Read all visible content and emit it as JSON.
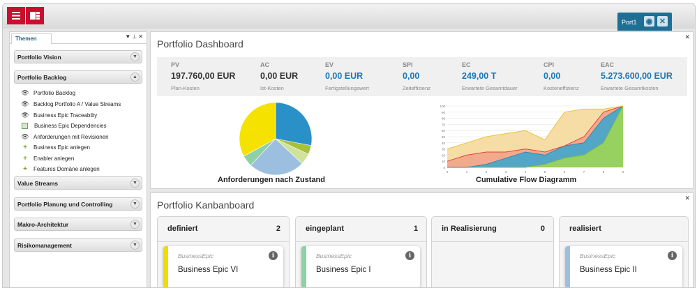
{
  "toolbar": {
    "menu_icon": "menu-icon",
    "layout_icon": "layout-icon"
  },
  "top_tab": {
    "label": "Port1"
  },
  "sidebar": {
    "tab_label": "Themen",
    "groups": [
      {
        "label": "Portfolio Vision",
        "expanded": false
      },
      {
        "label": "Portfolio Backlog",
        "expanded": true
      },
      {
        "label": "Value Streams",
        "expanded": false
      },
      {
        "label": "Portfolio Planung und Controlling",
        "expanded": false
      },
      {
        "label": "Makro-Architektur",
        "expanded": false
      },
      {
        "label": "Risikomanagement",
        "expanded": false
      }
    ],
    "items": [
      {
        "label": "Portfolio Backlog",
        "icon": "eye-icon"
      },
      {
        "label": "Backlog Portfolio A / Value Streams",
        "icon": "eye-icon"
      },
      {
        "label": "Business Epic Traceabilty",
        "icon": "eye-icon"
      },
      {
        "label": "Business Epic Dependencies",
        "icon": "diagram-icon"
      },
      {
        "label": "Anforderungen mit Revisionen",
        "icon": "eye-icon"
      },
      {
        "label": "Business Epic anlegen",
        "icon": "plus-icon"
      },
      {
        "label": "Enabler anlegen",
        "icon": "plus-icon"
      },
      {
        "label": "Features Domäne anlegen",
        "icon": "plus-icon"
      }
    ]
  },
  "dashboard": {
    "title": "Portfolio Dashboard",
    "kpis": [
      {
        "key": "PV",
        "value": "197.760,00 EUR",
        "sub": "Plan-Kosten",
        "color": "#333333"
      },
      {
        "key": "AC",
        "value": "0,00 EUR",
        "sub": "Ist-Kosten",
        "color": "#333333"
      },
      {
        "key": "EV",
        "value": "0,00 EUR",
        "sub": "Fertigstellungswert",
        "color": "#1a78b5"
      },
      {
        "key": "SPI",
        "value": "0,00",
        "sub": "Zeiteffizienz",
        "color": "#1a78b5"
      },
      {
        "key": "EC",
        "value": "249,00 T",
        "sub": "Erwartete Gesamtdauer",
        "color": "#1a78b5"
      },
      {
        "key": "CPI",
        "value": "0,00",
        "sub": "Kosteneffizienz",
        "color": "#1a78b5"
      },
      {
        "key": "EAC",
        "value": "5.273.600,00 EUR",
        "sub": "Erwartete Gesamtkosten",
        "color": "#1a78b5"
      }
    ],
    "pie_label": "Anforderungen nach Zustand",
    "cfd_label": "Cumulative Flow Diagramm"
  },
  "chart_data": [
    {
      "type": "pie",
      "title": "Anforderungen nach Zustand",
      "values": [
        28,
        4,
        5,
        25,
        5,
        33
      ],
      "colors": [
        "#2a90c8",
        "#a6c13a",
        "#cfe39a",
        "#9dbfdf",
        "#8fd0a6",
        "#f5e200"
      ]
    },
    {
      "type": "area",
      "title": "Cumulative Flow Diagramm",
      "x": [
        "0",
        "1",
        "2",
        "3",
        "4",
        "5",
        "6",
        "7",
        "8",
        "9"
      ],
      "ylim": [
        0,
        100
      ],
      "yticks": [
        "0",
        "10",
        "20",
        "30",
        "40",
        "50",
        "60",
        "70",
        "80",
        "90",
        "100"
      ],
      "series": [
        {
          "values": [
            0,
            0,
            0,
            0,
            0,
            5,
            15,
            20,
            40,
            100
          ],
          "color": "#9bd35a"
        },
        {
          "values": [
            0,
            0,
            5,
            15,
            25,
            20,
            35,
            40,
            80,
            100
          ],
          "color": "#4aa5c8"
        },
        {
          "values": [
            10,
            20,
            25,
            25,
            30,
            25,
            35,
            50,
            90,
            100
          ],
          "color": "#f2a58a"
        },
        {
          "values": [
            30,
            40,
            50,
            55,
            60,
            45,
            90,
            95,
            95,
            100
          ],
          "color": "#f5dba0"
        }
      ]
    }
  ],
  "kanban": {
    "title": "Portfolio Kanbanboard",
    "columns": [
      {
        "label": "definiert",
        "count": "2",
        "card": {
          "type": "BusinessEpic",
          "name": "Business Epic VI",
          "color": "#f0dc00"
        }
      },
      {
        "label": "eingeplant",
        "count": "1",
        "card": {
          "type": "BusinessEpic",
          "name": "Business Epic I",
          "color": "#8fd0a6"
        }
      },
      {
        "label": "in Realisierung",
        "count": "0",
        "card": null
      },
      {
        "label": "realisiert",
        "count": "",
        "card": {
          "type": "BusinessEpic",
          "name": "Business Epic II",
          "color": "#9dbfdf"
        }
      }
    ]
  }
}
